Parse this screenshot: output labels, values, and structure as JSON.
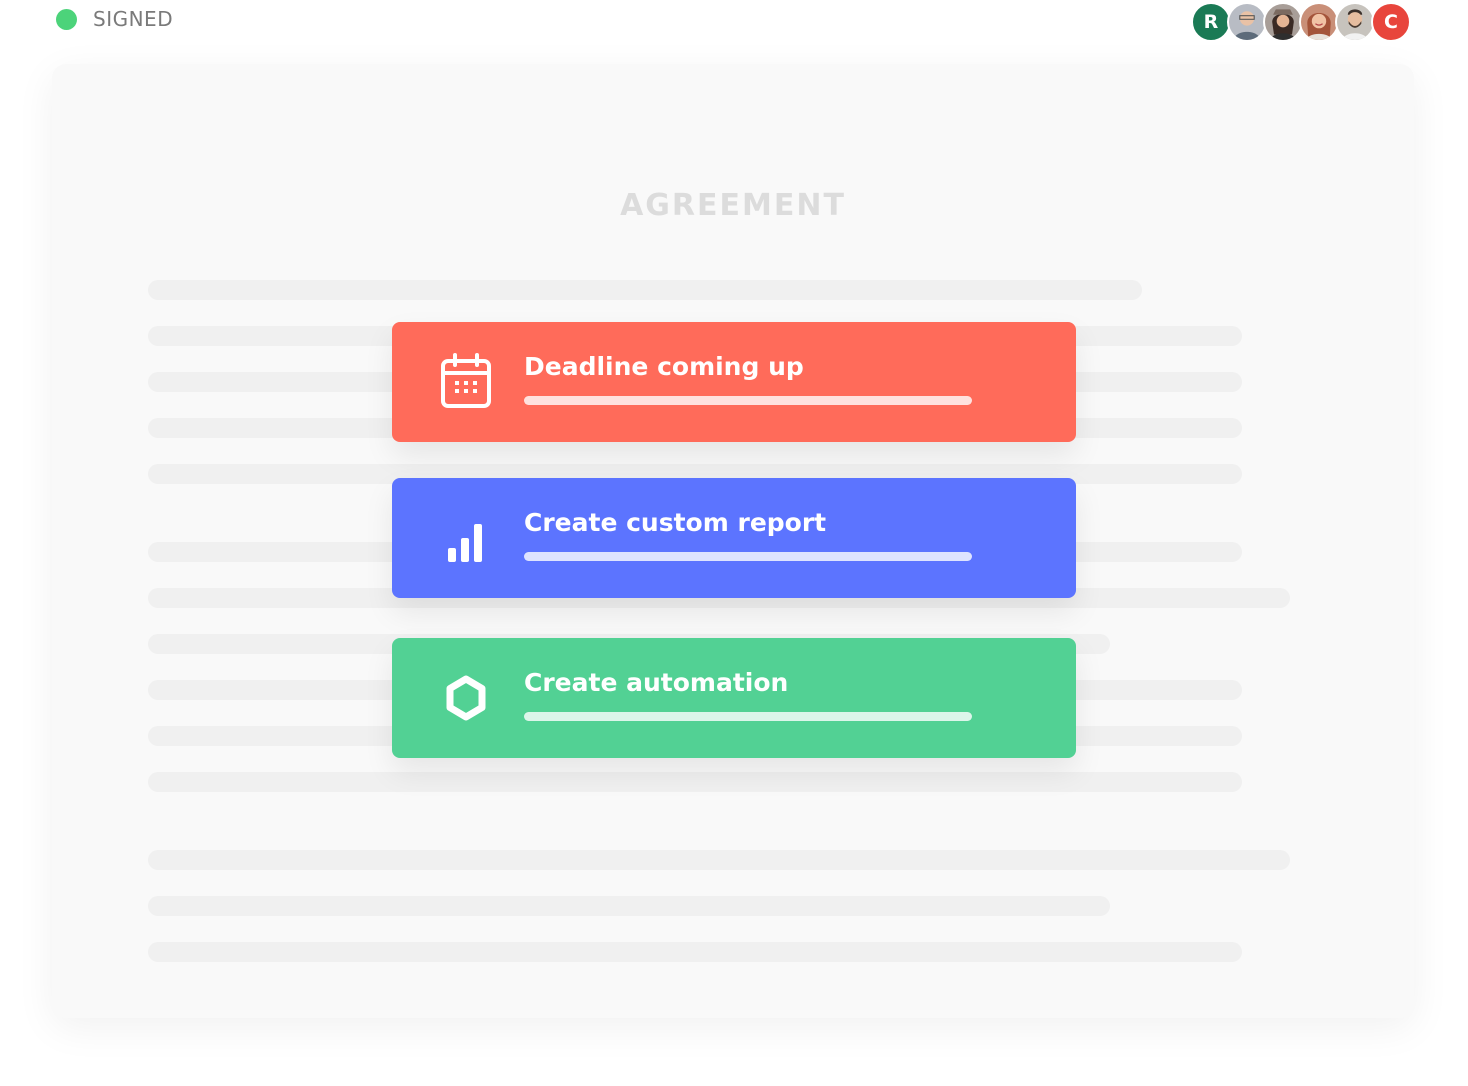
{
  "status": {
    "label": "SIGNED",
    "dot_color": "#4cd37a"
  },
  "avatars": [
    {
      "type": "initial",
      "initial": "R",
      "bg": "#1a7a55"
    },
    {
      "type": "photo",
      "icon": "man-glasses-photo",
      "bg": "#b8bcc4"
    },
    {
      "type": "photo",
      "icon": "woman-hat-photo",
      "bg": "#a89e98"
    },
    {
      "type": "photo",
      "icon": "woman-smiling-photo",
      "bg": "#c98f78"
    },
    {
      "type": "photo",
      "icon": "man-beard-photo",
      "bg": "#c7c3bd"
    },
    {
      "type": "initial",
      "initial": "C",
      "bg": "#e8453c"
    }
  ],
  "document": {
    "title": "AGREEMENT"
  },
  "cards": [
    {
      "label": "Deadline coming up",
      "color": "#ff6b5a",
      "icon": "calendar-icon"
    },
    {
      "label": "Create custom report",
      "color": "#5c74ff",
      "icon": "bar-chart-icon"
    },
    {
      "label": "Create automation",
      "color": "#52d194",
      "icon": "hexagon-icon"
    }
  ]
}
